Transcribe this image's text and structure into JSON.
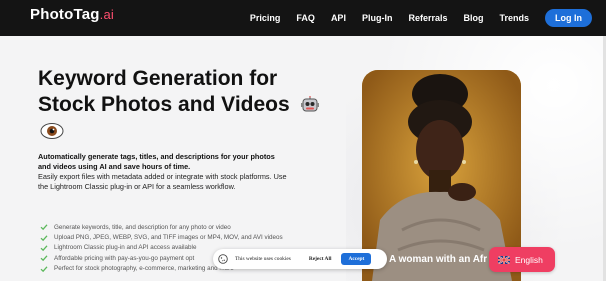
{
  "nav": {
    "logo_main": "PhotoTag",
    "logo_suffix": ".ai",
    "links": [
      "Pricing",
      "FAQ",
      "API",
      "Plug-In",
      "Referrals",
      "Blog",
      "Trends"
    ],
    "login_label": "Log In"
  },
  "hero": {
    "headline": "Keyword Generation for Stock Photos and Videos",
    "subhead": "Automatically generate tags, titles, and descriptions for your photos and videos using AI and save hours of time.",
    "description": "Easily export files with metadata added or integrate with stock platforms. Use the Lightroom Classic plug-in or API for a seamless workflow.",
    "features": [
      "Generate keywords, title, and description for any photo or video",
      "Upload PNG, JPEG, WEBP, SVG, and TIFF images or MP4, MOV, and AVI videos",
      "Lightroom Classic plug-in and API access available",
      "Affordable pricing with pay-as-you-go payment opt",
      "Perfect for stock photography, e-commerce, marketing and more"
    ]
  },
  "photo": {
    "caption": "A woman with an Afr"
  },
  "cookie": {
    "text": "This website uses cookies",
    "reject_label": "Reject All",
    "accept_label": "Accept"
  },
  "language": {
    "label": "English"
  },
  "colors": {
    "nav_bg": "#141414",
    "brand_accent": "#ff4f6f",
    "primary_blue": "#1e6fd9",
    "language_pink": "#ef3e62",
    "check_green": "#5cb85c"
  },
  "icons": [
    "robot-emoji-icon",
    "eye-emoji-icon",
    "check-icon",
    "cookie-icon",
    "uk-flag-icon"
  ]
}
